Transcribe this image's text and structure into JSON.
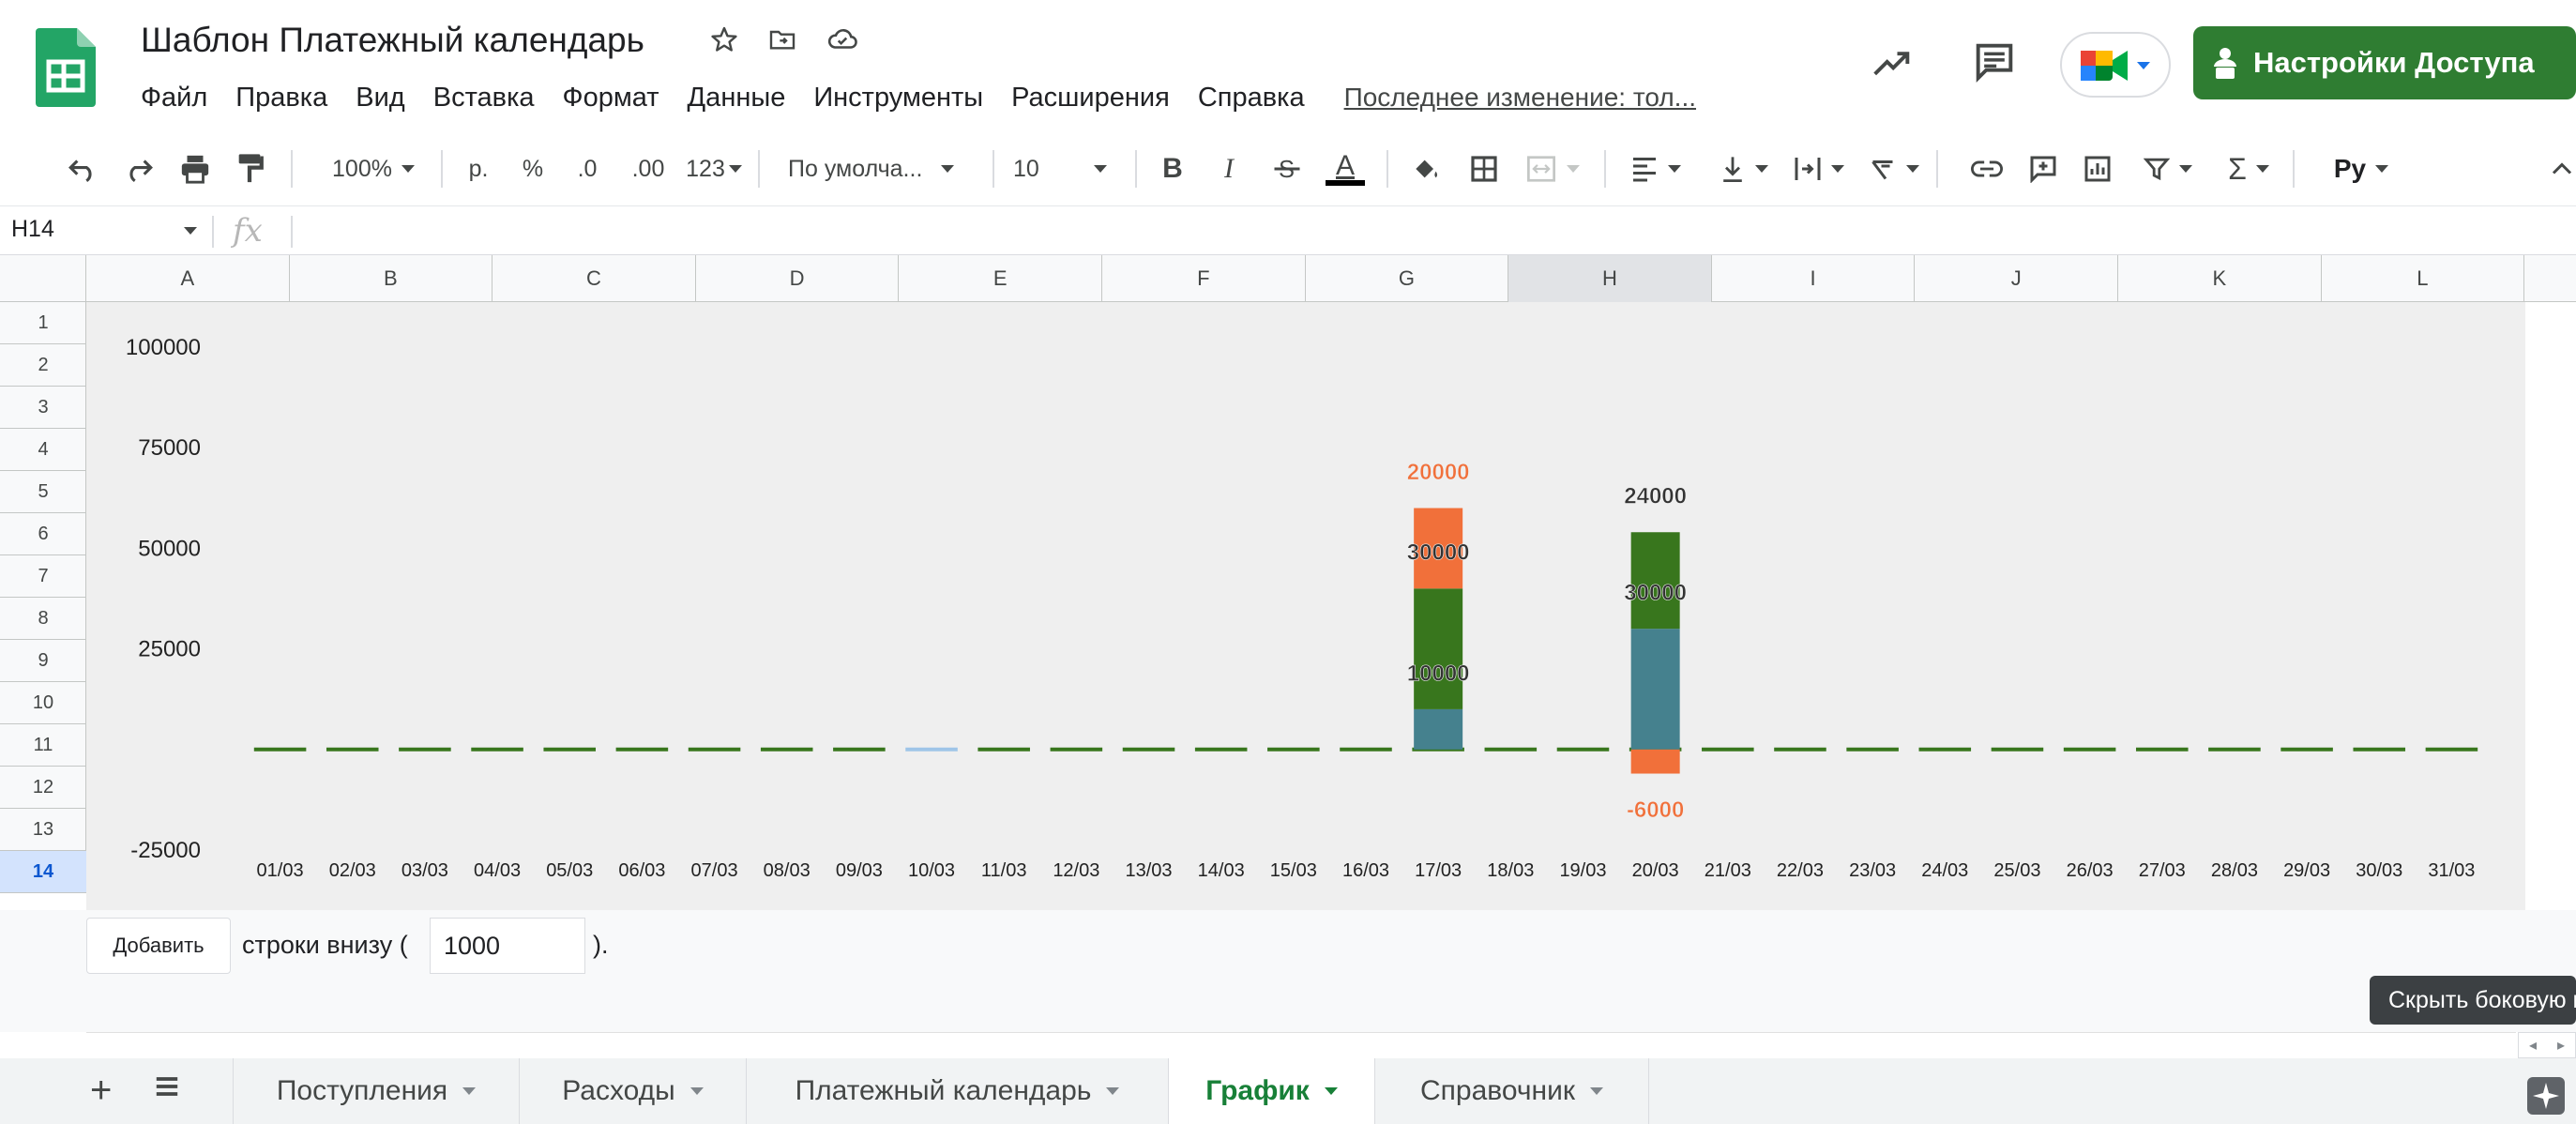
{
  "header": {
    "title": "Шаблон Платежный календарь",
    "menu": [
      "Файл",
      "Правка",
      "Вид",
      "Вставка",
      "Формат",
      "Данные",
      "Инструменты",
      "Расширения",
      "Справка"
    ],
    "last_edit": "Последнее изменение: тол...",
    "share_label": "Настройки Доступа",
    "brand_color": "#2f7d32"
  },
  "toolbar": {
    "zoom": "100%",
    "currency": "р.",
    "percent": "%",
    "decrease_decimals": ".0",
    "increase_decimals": ".00",
    "more_formats": "123",
    "font": "По умолча...",
    "font_size": "10",
    "bold": "B",
    "italic": "I",
    "text_color": "A",
    "input_tools": "Ру"
  },
  "formula_bar": {
    "cell_ref": "H14",
    "fx": "fx"
  },
  "columns": [
    "A",
    "B",
    "C",
    "D",
    "E",
    "F",
    "G",
    "H",
    "I",
    "J",
    "K",
    "L"
  ],
  "selected_column": "H",
  "rows": [
    "1",
    "2",
    "3",
    "4",
    "5",
    "6",
    "7",
    "8",
    "9",
    "10",
    "11",
    "12",
    "13",
    "14"
  ],
  "selected_row": "14",
  "chart_data": {
    "type": "bar",
    "stacked": true,
    "categories": [
      "01/03",
      "02/03",
      "03/03",
      "04/03",
      "05/03",
      "06/03",
      "07/03",
      "08/03",
      "09/03",
      "10/03",
      "11/03",
      "12/03",
      "13/03",
      "14/03",
      "15/03",
      "16/03",
      "17/03",
      "18/03",
      "19/03",
      "20/03",
      "21/03",
      "22/03",
      "23/03",
      "24/03",
      "25/03",
      "26/03",
      "27/03",
      "28/03",
      "29/03",
      "30/03",
      "31/03"
    ],
    "y_ticks": [
      "100000",
      "75000",
      "50000",
      "25000",
      "-25000"
    ],
    "ylim": [
      -25000,
      100000
    ],
    "baseline_marks": {
      "colors": [
        "#38761d",
        "#38761d",
        "#38761d",
        "#38761d",
        "#38761d",
        "#38761d",
        "#38761d",
        "#38761d",
        "#38761d",
        "#9fc5e8",
        "#38761d",
        "#38761d",
        "#38761d",
        "#38761d",
        "#38761d",
        "#38761d",
        "#38761d",
        "#38761d",
        "#38761d",
        "#38761d",
        "#38761d",
        "#38761d",
        "#38761d",
        "#38761d",
        "#38761d",
        "#38761d",
        "#38761d",
        "#38761d",
        "#38761d",
        "#38761d",
        "#38761d"
      ]
    },
    "stacks": [
      {
        "category": "17/03",
        "segments": [
          {
            "from": 0,
            "to": 10000,
            "color": "#45818e"
          },
          {
            "from": 10000,
            "to": 40000,
            "color": "#38761d"
          },
          {
            "from": 40000,
            "to": 60000,
            "color": "#f1703a"
          }
        ],
        "labels": [
          {
            "text": "10000",
            "value": 19000,
            "color": "#333333"
          },
          {
            "text": "30000",
            "value": 49000,
            "color": "#333333"
          },
          {
            "text": "20000",
            "value": 69000,
            "color": "#f1703a"
          }
        ]
      },
      {
        "category": "20/03",
        "segments": [
          {
            "from": 0,
            "to": 30000,
            "color": "#45818e"
          },
          {
            "from": 30000,
            "to": 54000,
            "color": "#38761d"
          },
          {
            "from": -6000,
            "to": 0,
            "color": "#f1703a"
          }
        ],
        "labels": [
          {
            "text": "30000",
            "value": 39000,
            "color": "#333333"
          },
          {
            "text": "24000",
            "value": 63000,
            "color": "#333333"
          },
          {
            "text": "-6000",
            "value": -15000,
            "color": "#f1703a"
          }
        ]
      }
    ],
    "title": "",
    "xlabel": "",
    "ylabel": "",
    "grid": false
  },
  "add_rows": {
    "button_label": "Добавить",
    "text": "строки внизу (",
    "value": "1000",
    "suffix": ")."
  },
  "tooltip": "Скрыть боковую панель",
  "sheet_tabs": [
    {
      "label": "Поступления",
      "active": false
    },
    {
      "label": "Расходы",
      "active": false
    },
    {
      "label": "Платежный календарь",
      "active": false
    },
    {
      "label": "График",
      "active": true
    },
    {
      "label": "Справочник",
      "active": false
    }
  ],
  "add_sheet_symbol": "+"
}
